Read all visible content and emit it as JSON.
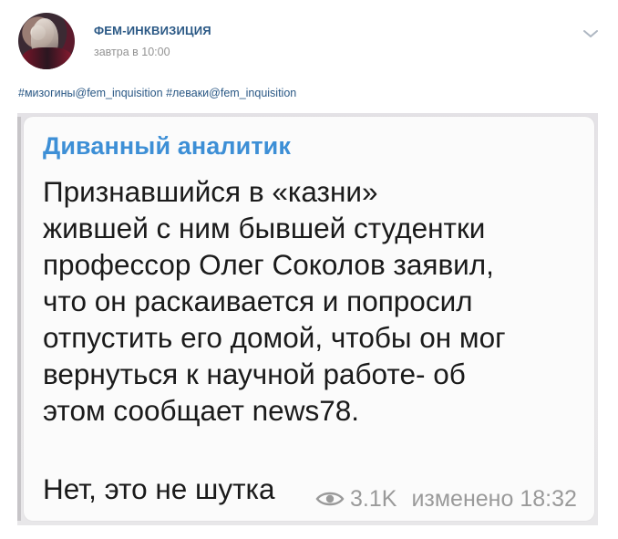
{
  "post": {
    "author": "ФЕМ-ИНКВИЗИЦИЯ",
    "time": "завтра в 10:00",
    "hashtags": [
      "#мизогины@fem_inquisition",
      "#леваки@fem_inquisition"
    ]
  },
  "screenshot": {
    "channel_name": "Диванный аналитик",
    "message_lines": [
      "Признавшийся в «казни»",
      "жившей с ним бывшей студентки",
      "профессор Олег Соколов заявил,",
      "что он раскаивается и попросил",
      "отпустить его домой, чтобы он мог",
      "вернуться к научной работе- об",
      "этом сообщает news78."
    ],
    "last_line": "Нет, это не шутка",
    "views": "3.1K",
    "edited": "изменено 18:32"
  },
  "icons": {
    "menu": "chevron-down-icon",
    "views": "eye-icon"
  }
}
